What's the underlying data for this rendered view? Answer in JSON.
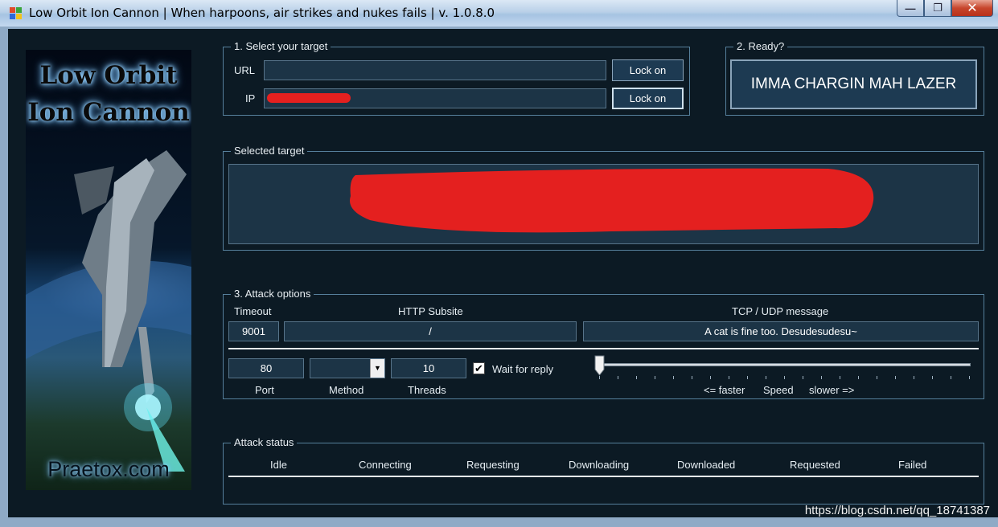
{
  "window": {
    "title": "Low Orbit Ion Cannon | When harpoons, air strikes and nukes fails | v. 1.0.8.0",
    "minimize": "—",
    "maximize": "❐",
    "close": "✕"
  },
  "banner": {
    "logo_line1": "Low Orbit",
    "logo_line2": "Ion Cannon",
    "site": "Praetox.com"
  },
  "target_group": {
    "label": "1. Select your target",
    "url_label": "URL",
    "url_value": "",
    "ip_label": "IP",
    "ip_value": "",
    "lock_on_url": "Lock on",
    "lock_on_ip": "Lock on"
  },
  "ready_group": {
    "label": "2. Ready?",
    "fire_button": "IMMA CHARGIN MAH LAZER"
  },
  "selected_target": {
    "label": "Selected target",
    "value": ""
  },
  "attack_options": {
    "label": "3. Attack options",
    "timeout_label": "Timeout",
    "timeout_value": "9001",
    "subsite_label": "HTTP Subsite",
    "subsite_value": "/",
    "message_label": "TCP / UDP message",
    "message_value": "A cat is fine too. Desudesudesu~",
    "port_value": "80",
    "port_label": "Port",
    "method_value": "",
    "method_label": "Method",
    "threads_value": "10",
    "threads_label": "Threads",
    "wait_for_reply_label": "Wait for reply",
    "wait_for_reply_checked": true,
    "checkmark": "✔",
    "speed_faster": "<= faster",
    "speed_label": "Speed",
    "speed_slower": "slower =>",
    "speed_level": 0
  },
  "attack_status": {
    "label": "Attack status",
    "columns": [
      "Idle",
      "Connecting",
      "Requesting",
      "Downloading",
      "Downloaded",
      "Requested",
      "Failed"
    ]
  },
  "watermark": "https://blog.csdn.net/qq_18741387",
  "colors": {
    "background": "#0c1a24",
    "field_bg": "#1c3446",
    "border": "#56809c",
    "redaction": "#e4201f"
  }
}
